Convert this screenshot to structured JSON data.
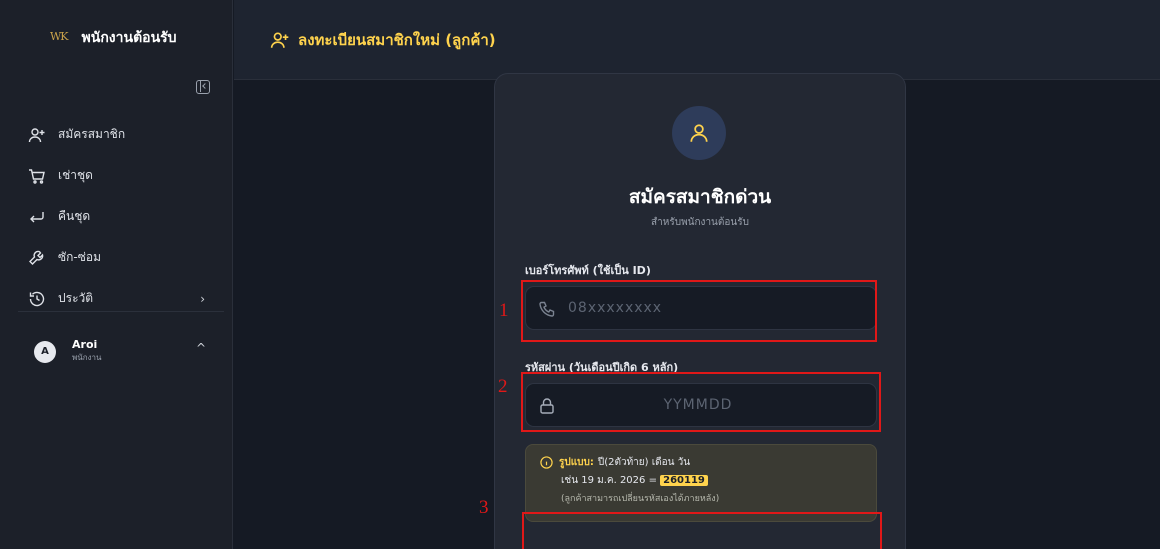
{
  "sidebar": {
    "brand_logo": "WK",
    "brand_title": "พนักงานต้อนรับ",
    "items": [
      {
        "label": "สมัครสมาชิก",
        "icon": "user-plus-icon"
      },
      {
        "label": "เช่าชุด",
        "icon": "cart-icon"
      },
      {
        "label": "คืนชุด",
        "icon": "return-icon"
      },
      {
        "label": "ซัก-ซ่อม",
        "icon": "wrench-icon"
      },
      {
        "label": "ประวัติ",
        "icon": "history-icon"
      }
    ],
    "user": {
      "initial": "A",
      "name": "Aroi",
      "role": "พนักงาน"
    }
  },
  "header": {
    "title": "ลงทะเบียนสมาชิกใหม่ (ลูกค้า)",
    "icon": "user-plus-icon"
  },
  "form": {
    "title": "สมัครสมาชิกด่วน",
    "subtitle": "สำหรับพนักงานต้อนรับ",
    "phone": {
      "label": "เบอร์โทรศัพท์ (ใช้เป็น ID)",
      "placeholder": "08xxxxxxxx",
      "value": ""
    },
    "password": {
      "label": "รหัสผ่าน (วันเดือนปีเกิด 6 หลัก)",
      "placeholder": "YYMMDD",
      "value": ""
    },
    "hint": {
      "label": "รูปแบบ:",
      "format": "ปี(2ตัวท้าย) เดือน วัน",
      "example_prefix": "เช่น 19 ม.ค. 2026 =",
      "example_value": "260119",
      "note": "(ลูกค้าสามารถเปลี่ยนรหัสเองได้ภายหลัง)"
    }
  },
  "annotations": [
    "1",
    "2",
    "3"
  ],
  "colors": {
    "accent": "#ffd34d",
    "annotation": "#e01818",
    "background": "#151a24"
  }
}
